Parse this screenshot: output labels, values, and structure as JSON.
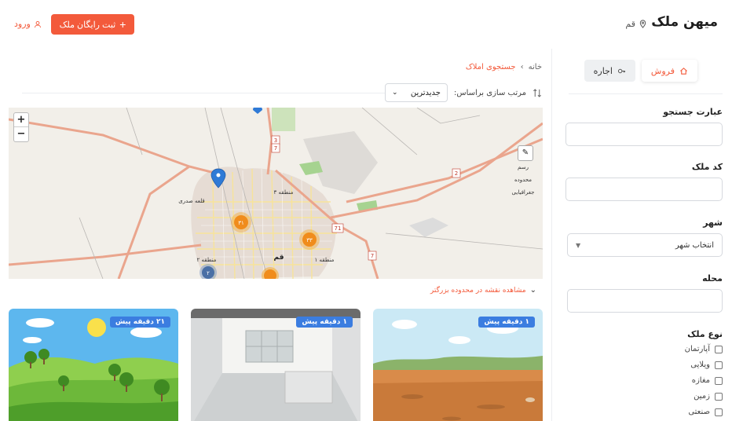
{
  "header": {
    "brand": "میهن ملک",
    "city": "قم",
    "register_button": "ثبت رایگان ملک",
    "login": "ورود"
  },
  "sidebar": {
    "tabs": [
      {
        "label": "فروش",
        "icon": "home-icon",
        "active": true
      },
      {
        "label": "اجاره",
        "icon": "key-icon",
        "active": false
      }
    ],
    "search_label": "عبارت جستجو",
    "code_label": "کد ملک",
    "city_label": "شهر",
    "city_select": "انتخاب شهر",
    "area_label": "محله",
    "type_label": "نوع ملک",
    "types": [
      "آپارتمان",
      "ویلایی",
      "مغازه",
      "زمین",
      "صنعتی"
    ]
  },
  "main": {
    "breadcrumb": [
      "خانه",
      "جستجوی املاک"
    ],
    "sort_label": "مرتب سازی براساس:",
    "sort_value": "جدیدترین",
    "map_hint": "مشاهده نقشه در محدوده بزرگتر",
    "map_labels": {
      "region3": "منطقه ۳",
      "region2": "منطقه ۲",
      "region1": "منطقه ۱",
      "qom": "قم",
      "qaleh": "قلعه صدری",
      "cluster1": "۳۱",
      "cluster2": "۳۳",
      "cluster3": "۲",
      "rasm": "رسم",
      "mahdoodeh": "محدوده",
      "jaghrafiai": "جغرافیایی",
      "road1": "3",
      "road2": "7",
      "road3": "2",
      "road4": "7",
      "road5": "71"
    },
    "cards": [
      {
        "badge": "۱ دقیقه پیش",
        "scene": "desert"
      },
      {
        "badge": "۱ دقیقه پیش",
        "scene": "room"
      },
      {
        "badge": "۲۱ دقیقه پیش",
        "scene": "hills"
      }
    ]
  },
  "colors": {
    "accent": "#f35a3b",
    "badge": "#3b7de0"
  }
}
